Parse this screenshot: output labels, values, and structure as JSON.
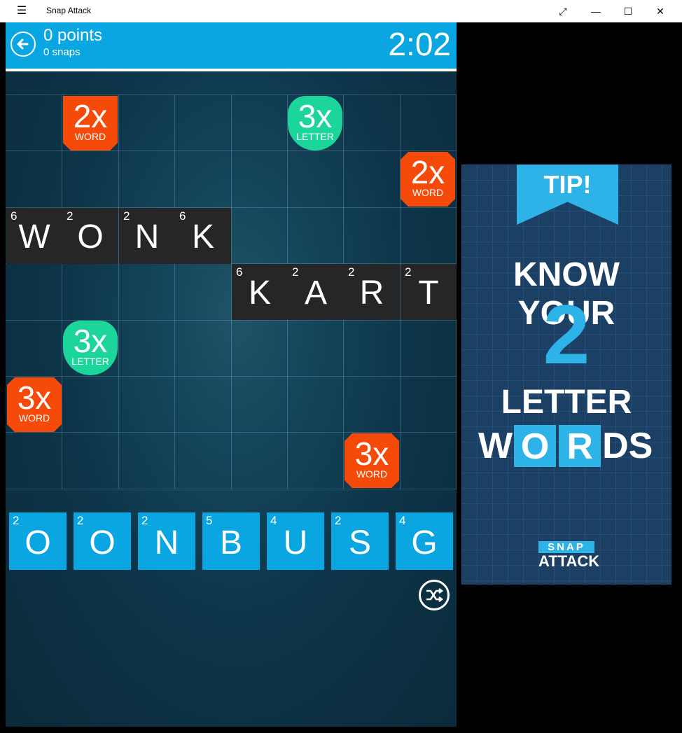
{
  "window": {
    "title": "Snap Attack",
    "menu_icon": "hamburger-icon",
    "fullscreen_icon": "expand-icon",
    "minimize_icon": "minimize-icon",
    "maximize_icon": "maximize-icon",
    "close_icon": "close-icon"
  },
  "header": {
    "points": "0 points",
    "snaps": "0 snaps",
    "timer": "2:02",
    "back_icon": "back-arrow-icon"
  },
  "board": {
    "placed_words": [
      {
        "word": "WONK",
        "tiles": [
          {
            "letter": "W",
            "points": "6"
          },
          {
            "letter": "O",
            "points": "2"
          },
          {
            "letter": "N",
            "points": "2"
          },
          {
            "letter": "K",
            "points": "6"
          }
        ]
      },
      {
        "word": "KART",
        "tiles": [
          {
            "letter": "K",
            "points": "6"
          },
          {
            "letter": "A",
            "points": "2"
          },
          {
            "letter": "R",
            "points": "2"
          },
          {
            "letter": "T",
            "points": "2"
          }
        ]
      }
    ],
    "bonuses": [
      {
        "multiplier": "2x",
        "type": "WORD"
      },
      {
        "multiplier": "3x",
        "type": "LETTER"
      },
      {
        "multiplier": "2x",
        "type": "WORD"
      },
      {
        "multiplier": "3x",
        "type": "LETTER"
      },
      {
        "multiplier": "3x",
        "type": "WORD"
      },
      {
        "multiplier": "3x",
        "type": "WORD"
      }
    ]
  },
  "rack": {
    "tiles": [
      {
        "letter": "O",
        "points": "2"
      },
      {
        "letter": "O",
        "points": "2"
      },
      {
        "letter": "N",
        "points": "2"
      },
      {
        "letter": "B",
        "points": "5"
      },
      {
        "letter": "U",
        "points": "4"
      },
      {
        "letter": "S",
        "points": "2"
      },
      {
        "letter": "G",
        "points": "4"
      }
    ],
    "shuffle_icon": "shuffle-icon"
  },
  "ad": {
    "ribbon": "TIP!",
    "line1": "KNOW YOUR",
    "number": "2",
    "line3": "LETTER",
    "line4": [
      "W",
      "O",
      "R",
      "DS"
    ],
    "logo_top": "SNAP",
    "logo_bottom": "ATTACK"
  },
  "colors": {
    "accent_blue": "#0aa6e2",
    "word_bonus": "#f64a0a",
    "letter_bonus": "#1cd59a",
    "placed_tile": "#262626"
  }
}
